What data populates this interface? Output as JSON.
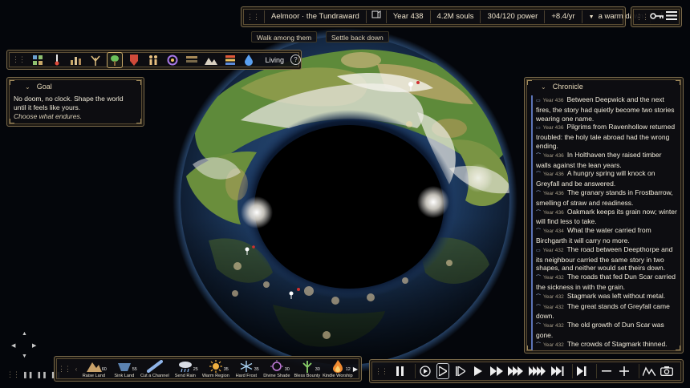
{
  "status": {
    "world_name": "Aelmoor · the Tundraward",
    "year": "Year 438",
    "souls": "4.2M souls",
    "power": "304/120 power",
    "rate": "+8.4/yr",
    "season": "a warm dawn",
    "icons": [
      "book-icon",
      "signal-icon"
    ]
  },
  "sub_buttons": {
    "walk": "Walk among them",
    "settle": "Settle back down"
  },
  "menu": {
    "icons": [
      "key-icon",
      "hamburger-menu-icon"
    ]
  },
  "layers": {
    "tools": [
      "tiles",
      "temperature",
      "elevation",
      "fertility",
      "vegetation",
      "culture",
      "population",
      "faith",
      "trade",
      "terrain",
      "rivers",
      "water"
    ],
    "active_tool": "vegetation",
    "label": "Living",
    "help": "?"
  },
  "goal": {
    "title": "Goal",
    "body": "No doom, no clock. Shape the world until it feels like yours.",
    "tagline": "Choose what endures."
  },
  "chronicle": {
    "title": "Chronicle",
    "entries": [
      {
        "icon": "road",
        "year": "Year 436",
        "text": "Between Deepwick and the next fires, the story had quietly become two stories wearing one name."
      },
      {
        "icon": "road",
        "year": "Year 436",
        "text": "Pilgrims from Ravenhollow returned troubled: the holy tale abroad had the wrong ending."
      },
      {
        "icon": "arc",
        "year": "Year 436",
        "text": "In Holthaven they raised timber walls against the lean years."
      },
      {
        "icon": "arc",
        "year": "Year 436",
        "text": "A hungry spring will knock on Greyfall and be answered."
      },
      {
        "icon": "arc",
        "year": "Year 436",
        "text": "The granary stands in Frostbarrow, smelling of straw and readiness."
      },
      {
        "icon": "arc",
        "year": "Year 436",
        "text": "Oakmark keeps its grain now; winter will find less to take."
      },
      {
        "icon": "arc",
        "year": "Year 434",
        "text": "What the water carried from Birchgarth it will carry no more."
      },
      {
        "icon": "road",
        "year": "Year 432",
        "text": "The road between Deepthorpe and its neighbour carried the same story in two shapes, and neither would set theirs down."
      },
      {
        "icon": "arc",
        "year": "Year 432",
        "text": "The roads that fed Dun Scar carried the sickness in with the grain."
      },
      {
        "icon": "arc",
        "year": "Year 432",
        "text": "Stagmark was left without metal."
      },
      {
        "icon": "arc",
        "year": "Year 432",
        "text": "The great stands of Greyfall came down."
      },
      {
        "icon": "arc",
        "year": "Year 432",
        "text": "The old growth of Dun Scar was gone."
      },
      {
        "icon": "arc",
        "year": "Year 432",
        "text": "The crowds of Stagmark thinned."
      }
    ]
  },
  "powers": [
    {
      "label": "Raise Land",
      "cost": "60",
      "icon": "mountain",
      "color": "#c9a26a"
    },
    {
      "label": "Sink Land",
      "cost": "55",
      "icon": "sink",
      "color": "#6fa0d8"
    },
    {
      "label": "Cut a Channel",
      "cost": "",
      "icon": "channel",
      "color": "#8fb4e8"
    },
    {
      "label": "Send Rain",
      "cost": "25",
      "icon": "rain",
      "color": "#d8dde6"
    },
    {
      "label": "Warm Region",
      "cost": "35",
      "icon": "sun",
      "color": "#f0b040"
    },
    {
      "label": "Hard Frost",
      "cost": "35",
      "icon": "frost",
      "color": "#a8d0f0"
    },
    {
      "label": "Divine Shade",
      "cost": "30",
      "icon": "shade",
      "color": "#c07ad8"
    },
    {
      "label": "Bless Bounty",
      "cost": "30",
      "icon": "bounty",
      "color": "#8ad06a"
    },
    {
      "label": "Kindle Worship",
      "cost": "12",
      "icon": "flame",
      "color": "#f08a30"
    }
  ],
  "speed": {
    "buttons": [
      "pause",
      "step",
      "play-1",
      "play-2",
      "play-3",
      "play-4",
      "play-5",
      "play-6",
      "skip-end",
      "zoom-out",
      "zoom-in",
      "terrain-view",
      "screenshot"
    ],
    "active": "play-1"
  },
  "colors": {
    "accent": "#c8a868",
    "panel_border": "#7a6a4a",
    "entry_bar": "#5c74b8"
  }
}
